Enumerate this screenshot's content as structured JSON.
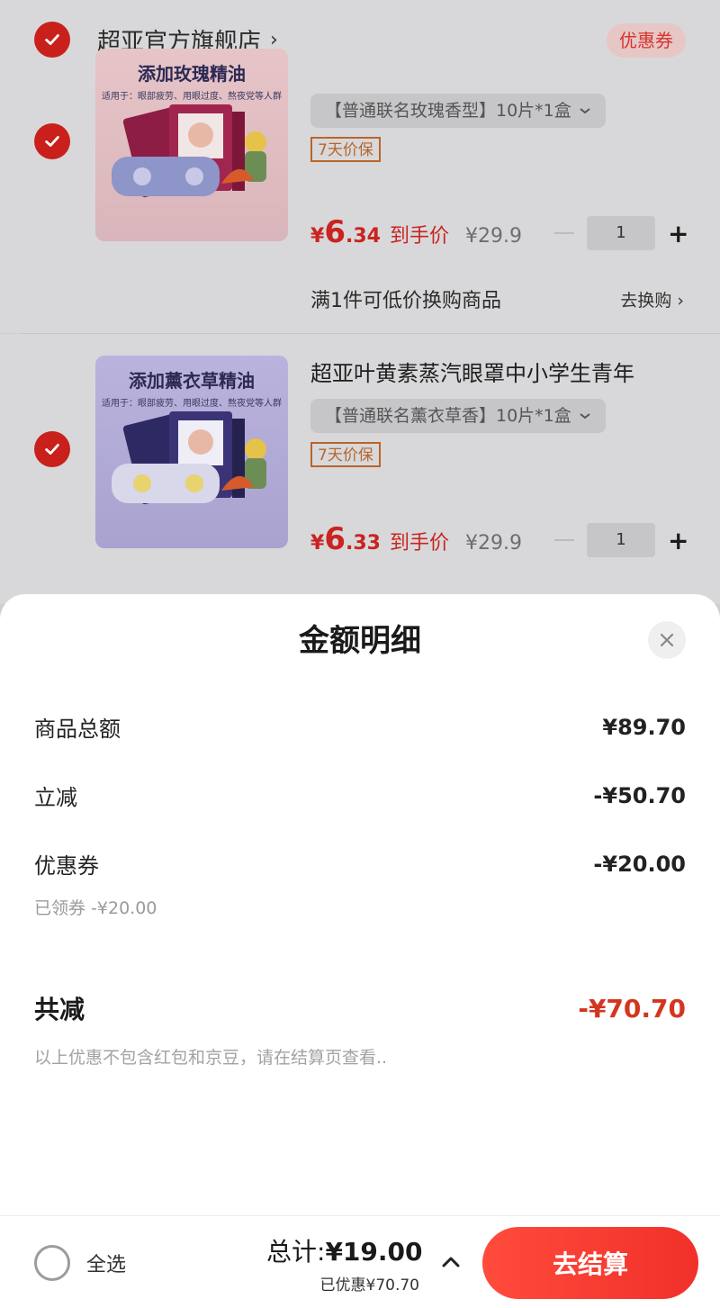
{
  "store": {
    "name": "超亚官方旗舰店",
    "chevron": "›",
    "coupon_label": "优惠券"
  },
  "items": [
    {
      "thumb_title": "添加玫瑰精油",
      "thumb_sub": "适用于：眼部疲劳、用眼过度、熬夜党等人群",
      "spec": "【普通联名玫瑰香型】10片*1盒",
      "badge": "7天价保",
      "price_currency": "¥",
      "price_int": "6",
      "price_dec": ".34",
      "price_label": "到手价",
      "price_orig": "¥29.9",
      "qty": "1"
    },
    {
      "thumb_title": "添加薰衣草精油",
      "thumb_sub": "适用于：眼部疲劳、用眼过度、熬夜党等人群",
      "title": "超亚叶黄素蒸汽眼罩中小学生青年",
      "spec": "【普通联名薰衣草香】10片*1盒",
      "badge": "7天价保",
      "price_currency": "¥",
      "price_int": "6",
      "price_dec": ".33",
      "price_label": "到手价",
      "price_orig": "¥29.9",
      "qty": "1"
    }
  ],
  "promo": {
    "text": "满1件可低价换购商品",
    "action": "去换购 ›"
  },
  "sheet": {
    "title": "金额明细",
    "rows": [
      {
        "label": "商品总额",
        "value": "¥89.70"
      },
      {
        "label": "立减",
        "value": "-¥50.70"
      },
      {
        "label": "优惠券",
        "value": "-¥20.00"
      }
    ],
    "coupon_note": "已领券 -¥20.00",
    "total_label": "共减",
    "total_value": "-¥70.70",
    "disclaimer": "以上优惠不包含红包和京豆，请在结算页查看.."
  },
  "bar": {
    "select_all": "全选",
    "total_prefix": "总计:",
    "total_value": "¥19.00",
    "saved": "已优惠¥70.70",
    "checkout": "去结算"
  },
  "colors": {
    "accent": "#f1302a",
    "price_red": "#c92420",
    "check_red": "#c9201c"
  }
}
